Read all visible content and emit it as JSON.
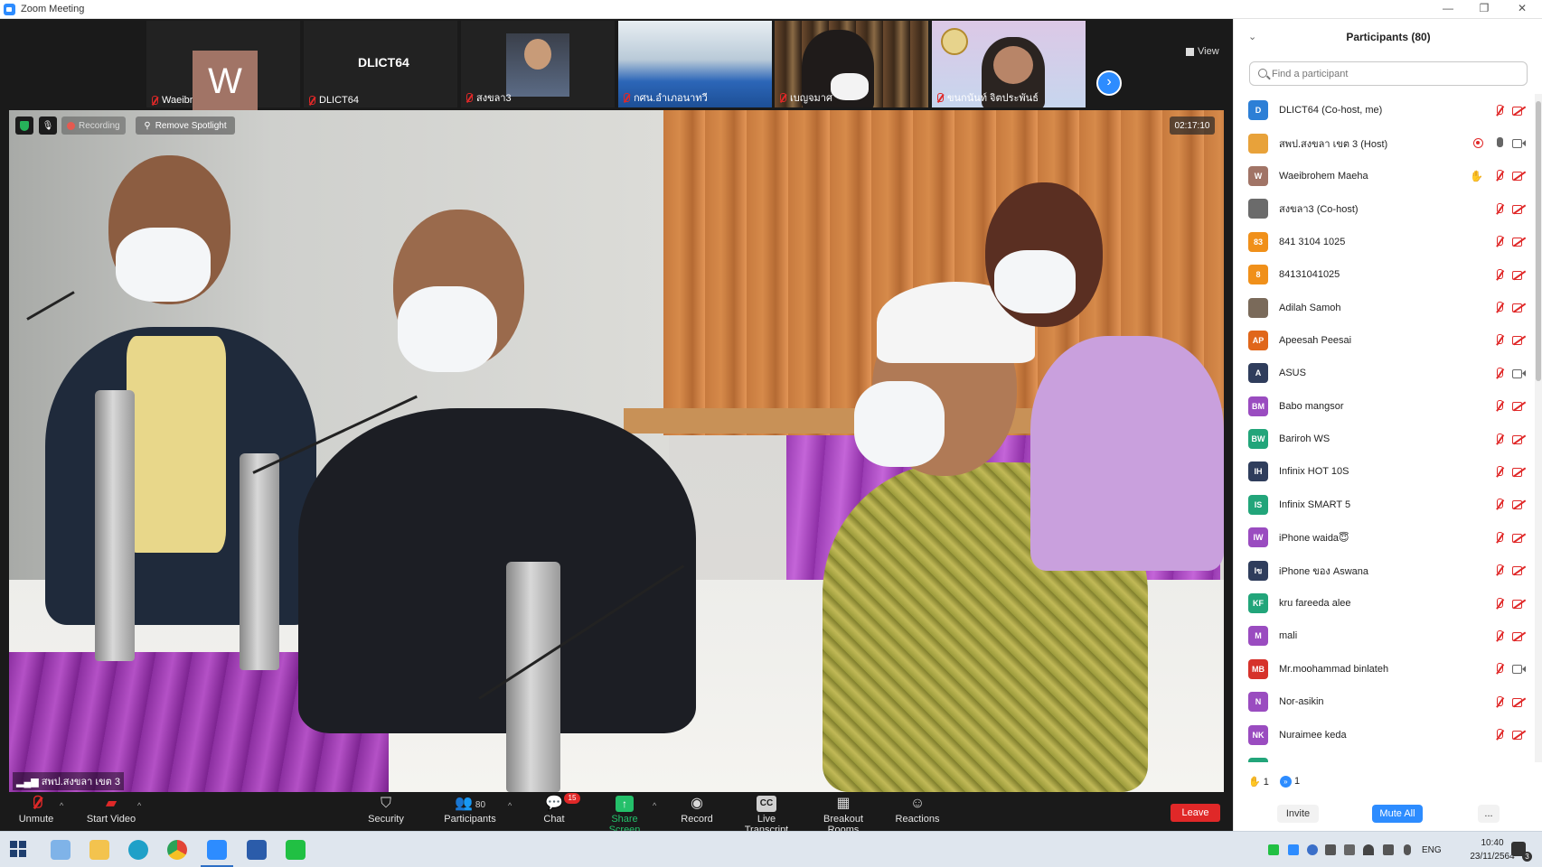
{
  "window": {
    "title": "Zoom Meeting",
    "controls": {
      "minimize": "—",
      "restore": "❐",
      "close": "✕"
    }
  },
  "filmstrip": {
    "view_label": "View",
    "tiles": [
      {
        "name": "Waeibrohem Maeha",
        "avatar_letter": "W",
        "raised_hand": true
      },
      {
        "name": "DLICT64",
        "display_text": "DLICT64"
      },
      {
        "name": "สงขลา3"
      },
      {
        "name": "กศน.อำเภอนาทวี"
      },
      {
        "name": "เบญจมาศ"
      },
      {
        "name": "ขนกนันท์ จิตประพันธ์"
      }
    ]
  },
  "main_video": {
    "recording_label": "Recording",
    "spotlight_label": "Remove Spotlight",
    "timer": "02:17:10",
    "speaker_name": "สพป.สงขลา เขต 3"
  },
  "toolbar": {
    "unmute": "Unmute",
    "start_video": "Start Video",
    "security": "Security",
    "participants": "Participants",
    "participants_count": "80",
    "chat": "Chat",
    "chat_badge": "15",
    "share_screen": "Share Screen",
    "record": "Record",
    "live_transcript": "Live Transcript",
    "live_transcript_icon": "CC",
    "breakout_rooms": "Breakout Rooms",
    "reactions": "Reactions",
    "leave": "Leave"
  },
  "panel": {
    "title": "Participants (80)",
    "search_placeholder": "Find a participant",
    "participants": [
      {
        "initials": "D",
        "color": "#2d7fd6",
        "name": "DLICT64 (Co-host, me)",
        "mic": "off",
        "video": "off"
      },
      {
        "initials": "",
        "color": "#e8a23a",
        "name": "สพป.สงขลา เขต 3 (Host)",
        "mic": "on",
        "video": "on",
        "recording": true
      },
      {
        "initials": "W",
        "color": "#a17466",
        "name": "Waeibrohem Maeha",
        "mic": "off",
        "video": "off",
        "hand": true
      },
      {
        "initials": "",
        "color": "#6b6b6b",
        "name": "สงขลา3 (Co-host)",
        "mic": "off",
        "video": "off"
      },
      {
        "initials": "83",
        "color": "#f0901a",
        "name": "841 3104 1025",
        "mic": "off",
        "video": "off"
      },
      {
        "initials": "8",
        "color": "#f0901a",
        "name": "84131041025",
        "mic": "off",
        "video": "off"
      },
      {
        "initials": "",
        "color": "#7a6a5a",
        "name": "Adilah Samoh",
        "mic": "off",
        "video": "off"
      },
      {
        "initials": "AP",
        "color": "#e0661a",
        "name": "Apeesah  Peesai",
        "mic": "off",
        "video": "off"
      },
      {
        "initials": "A",
        "color": "#2f3d5c",
        "name": "ASUS",
        "mic": "off",
        "video": "on"
      },
      {
        "initials": "BM",
        "color": "#9a4cc0",
        "name": "Babo mangsor",
        "mic": "off",
        "video": "off"
      },
      {
        "initials": "BW",
        "color": "#22a57a",
        "name": "Bariroh WS",
        "mic": "off",
        "video": "off"
      },
      {
        "initials": "IH",
        "color": "#2f3d5c",
        "name": "Infinix HOT 10S",
        "mic": "off",
        "video": "off"
      },
      {
        "initials": "IS",
        "color": "#22a57a",
        "name": "Infinix SMART 5",
        "mic": "off",
        "video": "off"
      },
      {
        "initials": "IW",
        "color": "#9a4cc0",
        "name": "iPhone waida😇",
        "mic": "off",
        "video": "off"
      },
      {
        "initials": "Iข",
        "color": "#2f3d5c",
        "name": "iPhone ของ Aswana",
        "mic": "off",
        "video": "off"
      },
      {
        "initials": "KF",
        "color": "#22a57a",
        "name": "kru fareeda alee",
        "mic": "off",
        "video": "off"
      },
      {
        "initials": "M",
        "color": "#9a4cc0",
        "name": "mali",
        "mic": "off",
        "video": "off"
      },
      {
        "initials": "MB",
        "color": "#d6322b",
        "name": "Mr.moohammad binlateh",
        "mic": "off",
        "video": "on"
      },
      {
        "initials": "N",
        "color": "#9a4cc0",
        "name": "Nor-asikin",
        "mic": "off",
        "video": "off"
      },
      {
        "initials": "NK",
        "color": "#9a4cc0",
        "name": "Nuraimee  keda",
        "mic": "off",
        "video": "off"
      },
      {
        "initials": "",
        "color": "#22a57a",
        "name": "",
        "mic": "off",
        "video": "off"
      }
    ],
    "raised_hands_count": "1",
    "go_faster_count": "1",
    "invite": "Invite",
    "mute_all": "Mute All",
    "more": "..."
  },
  "taskbar": {
    "language": "ENG",
    "time": "10:40",
    "date": "23/11/2564",
    "notification_count": "3"
  }
}
